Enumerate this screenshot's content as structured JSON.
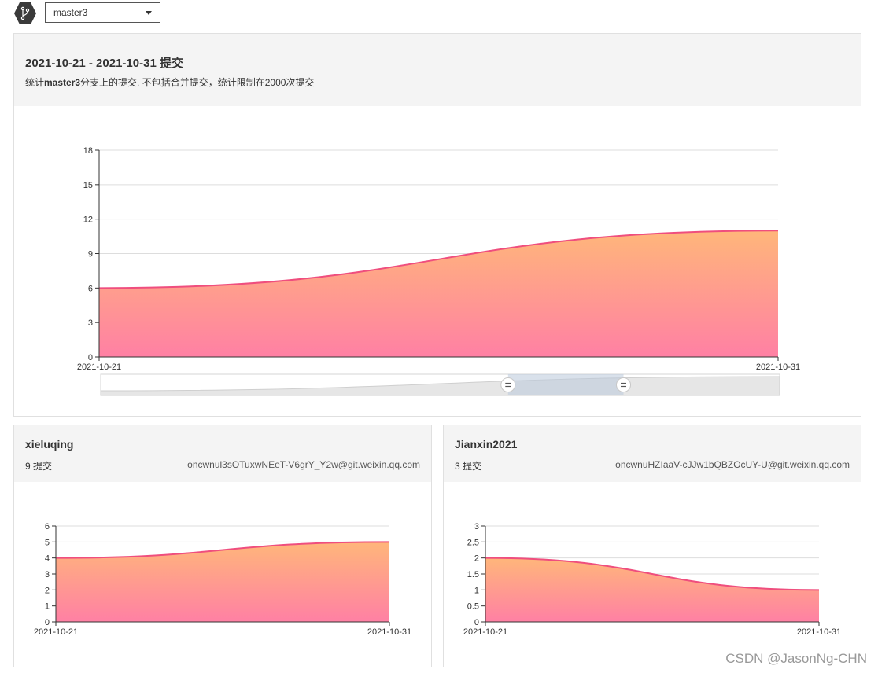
{
  "branch": {
    "selected": "master3"
  },
  "main": {
    "title": "2021-10-21 - 2021-10-31 提交",
    "desc_prefix": "统计",
    "desc_branch": "master3",
    "desc_suffix": "分支上的提交, 不包括合并提交，统计限制在2000次提交"
  },
  "contributors": [
    {
      "name": "xieluqing",
      "count_label": "9 提交",
      "email": "oncwnul3sOTuxwNEeT-V6grY_Y2w@git.weixin.qq.com"
    },
    {
      "name": "Jianxin2021",
      "count_label": "3 提交",
      "email": "oncwnuHZIaaV-cJJw1bQBZOcUY-U@git.weixin.qq.com"
    }
  ],
  "watermark": "CSDN @JasonNg-CHN",
  "colors": {
    "area_top": "#ffb67a",
    "area_bottom": "#ff80a4",
    "line": "#ef4e7e",
    "branch_icon": "#3a3a3a"
  },
  "chart_data": [
    {
      "type": "area",
      "x": [
        "2021-10-21",
        "2021-10-31"
      ],
      "values": [
        6,
        11
      ],
      "ylim": [
        0,
        18
      ],
      "yticks": [
        0,
        3,
        6,
        9,
        12,
        15,
        18
      ],
      "grid": true,
      "has_zoom_slider": true,
      "zoom_range_percent": [
        60,
        77
      ]
    },
    {
      "type": "area",
      "x": [
        "2021-10-21",
        "2021-10-31"
      ],
      "values": [
        4,
        5
      ],
      "ylim": [
        0,
        6
      ],
      "yticks": [
        0,
        1,
        2,
        3,
        4,
        5,
        6
      ],
      "grid": true
    },
    {
      "type": "area",
      "x": [
        "2021-10-21",
        "2021-10-31"
      ],
      "values": [
        2,
        1
      ],
      "ylim": [
        0,
        3
      ],
      "yticks": [
        0,
        0.5,
        1,
        1.5,
        2,
        2.5,
        3
      ],
      "grid": true
    }
  ]
}
